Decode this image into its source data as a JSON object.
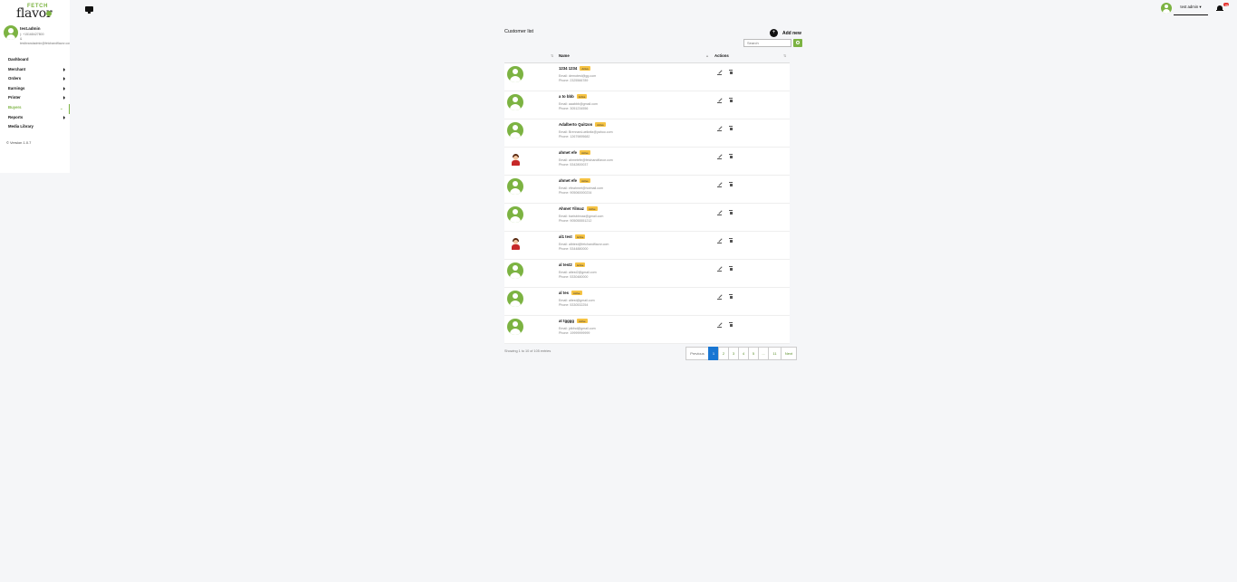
{
  "brand": {
    "top": "FETCH",
    "bottom": "flavor"
  },
  "user": {
    "name": "test.admin",
    "phone": "(: +15168427800",
    "amp": "&",
    "email": "testbrandadmin@fetchandflavor.com"
  },
  "nav": [
    {
      "label": "Dashboard"
    },
    {
      "label": "Merchant"
    },
    {
      "label": "Orders"
    },
    {
      "label": "Earnings"
    },
    {
      "label": "Printer"
    },
    {
      "label": "Buyers"
    },
    {
      "label": "Reports"
    },
    {
      "label": "Media Library"
    }
  ],
  "version": "© Version 1.0.7",
  "topbar": {
    "user_label": "test admin ▾",
    "notif_count": "99"
  },
  "page": {
    "title": "Customer list",
    "add_new": "Add new",
    "search_placeholder": "Search",
    "headers": {
      "name": "Name",
      "actions": "Actions"
    }
  },
  "customers": [
    {
      "name": "1234 1234",
      "badge": "Active",
      "email": "Email: demotest@gg.com",
      "phone": "Phone: 2325566789",
      "avatar": "default"
    },
    {
      "name": "a to bbb",
      "badge": "Active",
      "email": "Email: aaabbb@gmail.com",
      "phone": "Phone: 3051234556",
      "avatar": "default"
    },
    {
      "name": "Adalberto Quitzon",
      "badge": "Active",
      "email": "Email: BrennanLueilwitz@yahoo.com",
      "phone": "Phone: 12679895682",
      "avatar": "default"
    },
    {
      "name": "ahmet efe",
      "badge": "Active",
      "email": "Email: ahmetefe@fetchandflavor.com",
      "phone": "Phone: 5342800037",
      "avatar": "photo"
    },
    {
      "name": "ahmet efe",
      "badge": "Active",
      "email": "Email: efeahmet@hotmail.com",
      "phone": "Phone: 905060000234",
      "avatar": "default"
    },
    {
      "name": "Ahmet Yilmaz",
      "badge": "Active",
      "email": "Email: barisbinnaz@gmail.com",
      "phone": "Phone: 905055551212",
      "avatar": "default"
    },
    {
      "name": "al1 test",
      "badge": "Active",
      "email": "Email: albtest@fetchandflavor.com",
      "phone": "Phone: 5344880000",
      "avatar": "photo"
    },
    {
      "name": "al test2",
      "badge": "Active",
      "email": "Email: altest2@gmail.com",
      "phone": "Phone: 5330480000",
      "avatar": "default"
    },
    {
      "name": "al tes",
      "badge": "Active",
      "email": "Email: altest@gmail.com",
      "phone": "Phone: 5330532254",
      "avatar": "default"
    },
    {
      "name": "at tgggg",
      "badge": "Active",
      "email": "Email: jdkfnd@gmail.com",
      "phone": "Phone: 19999999999",
      "avatar": "default"
    }
  ],
  "footer": {
    "showing": "Showing 1 to 10 of 105 entries",
    "pages": [
      "Previous",
      "1",
      "2",
      "3",
      "4",
      "5",
      "...",
      "11",
      "Next"
    ]
  },
  "colors": {
    "accent": "#7cb342",
    "active_page": "#1976d2",
    "badge": "#f6c343"
  }
}
